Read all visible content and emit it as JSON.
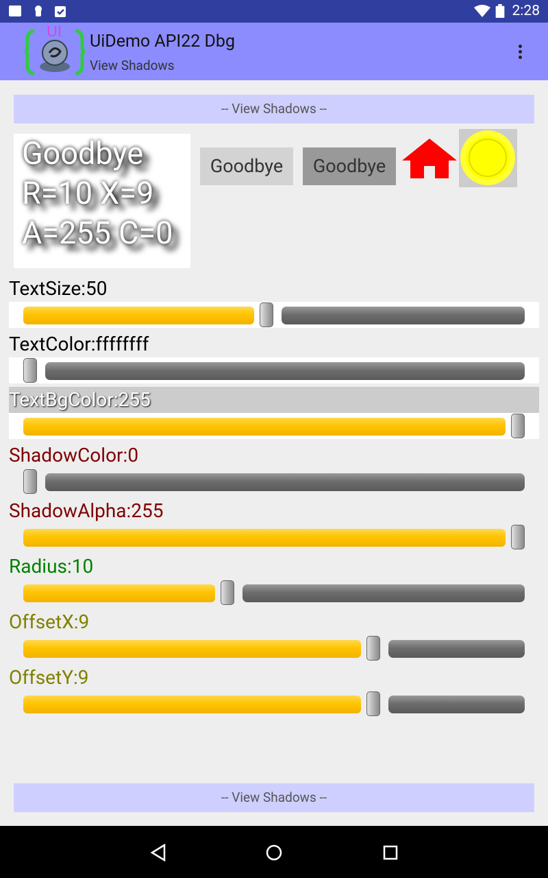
{
  "status_bar": {
    "time": "2:28"
  },
  "app_bar": {
    "title": "UiDemo API22 Dbg",
    "subtitle": "View Shadows",
    "logo_text": "UI"
  },
  "banner_top": "-- View Shadows --",
  "banner_bottom": "-- View Shadows --",
  "demo": {
    "shadow_lines": [
      "Goodbye",
      "R=10 X=9",
      "A=255 C=0"
    ],
    "button1": "Goodbye",
    "button2": "Goodbye"
  },
  "controls": [
    {
      "label": "TextSize:50",
      "color": "#000000",
      "value": 0.485
    },
    {
      "label": "TextColor:ffffffff",
      "color": "#000000",
      "value": 0.0
    },
    {
      "label": "TextBgColor:255",
      "color": "#ffffff",
      "value": 1.0
    },
    {
      "label": "ShadowColor:0",
      "color": "#800000",
      "value": 0.0
    },
    {
      "label": "ShadowAlpha:255",
      "color": "#800000",
      "value": 1.0
    },
    {
      "label": "Radius:10",
      "color": "#008000",
      "value": 0.405
    },
    {
      "label": "OffsetX:9",
      "color": "#808000",
      "value": 0.703
    },
    {
      "label": "OffsetY:9",
      "color": "#808000",
      "value": 0.703
    }
  ],
  "colors": {
    "status_bar": "#303f9f",
    "app_bar": "#8c8cff",
    "banner": "#cfcfff",
    "accent_fill": "#ffc400"
  },
  "icons": {
    "home": "home-icon",
    "circle": "yellow-circle-icon",
    "back": "back-icon",
    "home_nav": "home-nav-icon",
    "recents": "recents-icon"
  }
}
